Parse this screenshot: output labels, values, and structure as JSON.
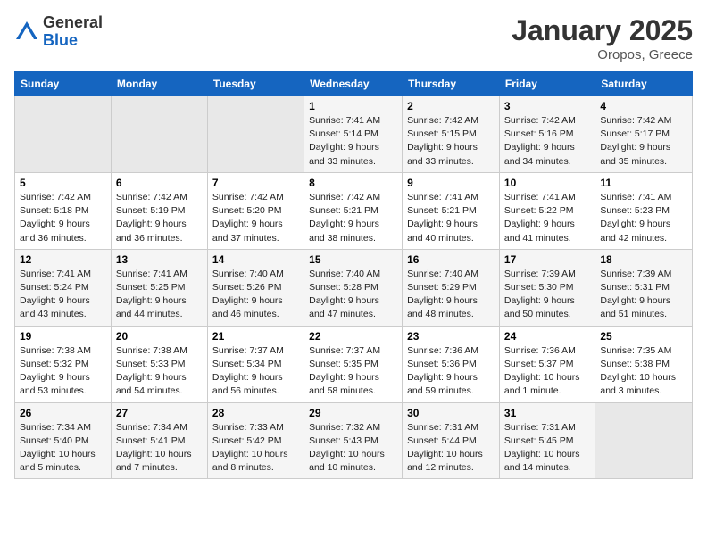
{
  "header": {
    "logo_line1": "General",
    "logo_line2": "Blue",
    "month": "January 2025",
    "location": "Oropos, Greece"
  },
  "weekdays": [
    "Sunday",
    "Monday",
    "Tuesday",
    "Wednesday",
    "Thursday",
    "Friday",
    "Saturday"
  ],
  "weeks": [
    [
      {
        "day": "",
        "info": ""
      },
      {
        "day": "",
        "info": ""
      },
      {
        "day": "",
        "info": ""
      },
      {
        "day": "1",
        "info": "Sunrise: 7:41 AM\nSunset: 5:14 PM\nDaylight: 9 hours\nand 33 minutes."
      },
      {
        "day": "2",
        "info": "Sunrise: 7:42 AM\nSunset: 5:15 PM\nDaylight: 9 hours\nand 33 minutes."
      },
      {
        "day": "3",
        "info": "Sunrise: 7:42 AM\nSunset: 5:16 PM\nDaylight: 9 hours\nand 34 minutes."
      },
      {
        "day": "4",
        "info": "Sunrise: 7:42 AM\nSunset: 5:17 PM\nDaylight: 9 hours\nand 35 minutes."
      }
    ],
    [
      {
        "day": "5",
        "info": "Sunrise: 7:42 AM\nSunset: 5:18 PM\nDaylight: 9 hours\nand 36 minutes."
      },
      {
        "day": "6",
        "info": "Sunrise: 7:42 AM\nSunset: 5:19 PM\nDaylight: 9 hours\nand 36 minutes."
      },
      {
        "day": "7",
        "info": "Sunrise: 7:42 AM\nSunset: 5:20 PM\nDaylight: 9 hours\nand 37 minutes."
      },
      {
        "day": "8",
        "info": "Sunrise: 7:42 AM\nSunset: 5:21 PM\nDaylight: 9 hours\nand 38 minutes."
      },
      {
        "day": "9",
        "info": "Sunrise: 7:41 AM\nSunset: 5:21 PM\nDaylight: 9 hours\nand 40 minutes."
      },
      {
        "day": "10",
        "info": "Sunrise: 7:41 AM\nSunset: 5:22 PM\nDaylight: 9 hours\nand 41 minutes."
      },
      {
        "day": "11",
        "info": "Sunrise: 7:41 AM\nSunset: 5:23 PM\nDaylight: 9 hours\nand 42 minutes."
      }
    ],
    [
      {
        "day": "12",
        "info": "Sunrise: 7:41 AM\nSunset: 5:24 PM\nDaylight: 9 hours\nand 43 minutes."
      },
      {
        "day": "13",
        "info": "Sunrise: 7:41 AM\nSunset: 5:25 PM\nDaylight: 9 hours\nand 44 minutes."
      },
      {
        "day": "14",
        "info": "Sunrise: 7:40 AM\nSunset: 5:26 PM\nDaylight: 9 hours\nand 46 minutes."
      },
      {
        "day": "15",
        "info": "Sunrise: 7:40 AM\nSunset: 5:28 PM\nDaylight: 9 hours\nand 47 minutes."
      },
      {
        "day": "16",
        "info": "Sunrise: 7:40 AM\nSunset: 5:29 PM\nDaylight: 9 hours\nand 48 minutes."
      },
      {
        "day": "17",
        "info": "Sunrise: 7:39 AM\nSunset: 5:30 PM\nDaylight: 9 hours\nand 50 minutes."
      },
      {
        "day": "18",
        "info": "Sunrise: 7:39 AM\nSunset: 5:31 PM\nDaylight: 9 hours\nand 51 minutes."
      }
    ],
    [
      {
        "day": "19",
        "info": "Sunrise: 7:38 AM\nSunset: 5:32 PM\nDaylight: 9 hours\nand 53 minutes."
      },
      {
        "day": "20",
        "info": "Sunrise: 7:38 AM\nSunset: 5:33 PM\nDaylight: 9 hours\nand 54 minutes."
      },
      {
        "day": "21",
        "info": "Sunrise: 7:37 AM\nSunset: 5:34 PM\nDaylight: 9 hours\nand 56 minutes."
      },
      {
        "day": "22",
        "info": "Sunrise: 7:37 AM\nSunset: 5:35 PM\nDaylight: 9 hours\nand 58 minutes."
      },
      {
        "day": "23",
        "info": "Sunrise: 7:36 AM\nSunset: 5:36 PM\nDaylight: 9 hours\nand 59 minutes."
      },
      {
        "day": "24",
        "info": "Sunrise: 7:36 AM\nSunset: 5:37 PM\nDaylight: 10 hours\nand 1 minute."
      },
      {
        "day": "25",
        "info": "Sunrise: 7:35 AM\nSunset: 5:38 PM\nDaylight: 10 hours\nand 3 minutes."
      }
    ],
    [
      {
        "day": "26",
        "info": "Sunrise: 7:34 AM\nSunset: 5:40 PM\nDaylight: 10 hours\nand 5 minutes."
      },
      {
        "day": "27",
        "info": "Sunrise: 7:34 AM\nSunset: 5:41 PM\nDaylight: 10 hours\nand 7 minutes."
      },
      {
        "day": "28",
        "info": "Sunrise: 7:33 AM\nSunset: 5:42 PM\nDaylight: 10 hours\nand 8 minutes."
      },
      {
        "day": "29",
        "info": "Sunrise: 7:32 AM\nSunset: 5:43 PM\nDaylight: 10 hours\nand 10 minutes."
      },
      {
        "day": "30",
        "info": "Sunrise: 7:31 AM\nSunset: 5:44 PM\nDaylight: 10 hours\nand 12 minutes."
      },
      {
        "day": "31",
        "info": "Sunrise: 7:31 AM\nSunset: 5:45 PM\nDaylight: 10 hours\nand 14 minutes."
      },
      {
        "day": "",
        "info": ""
      }
    ]
  ]
}
